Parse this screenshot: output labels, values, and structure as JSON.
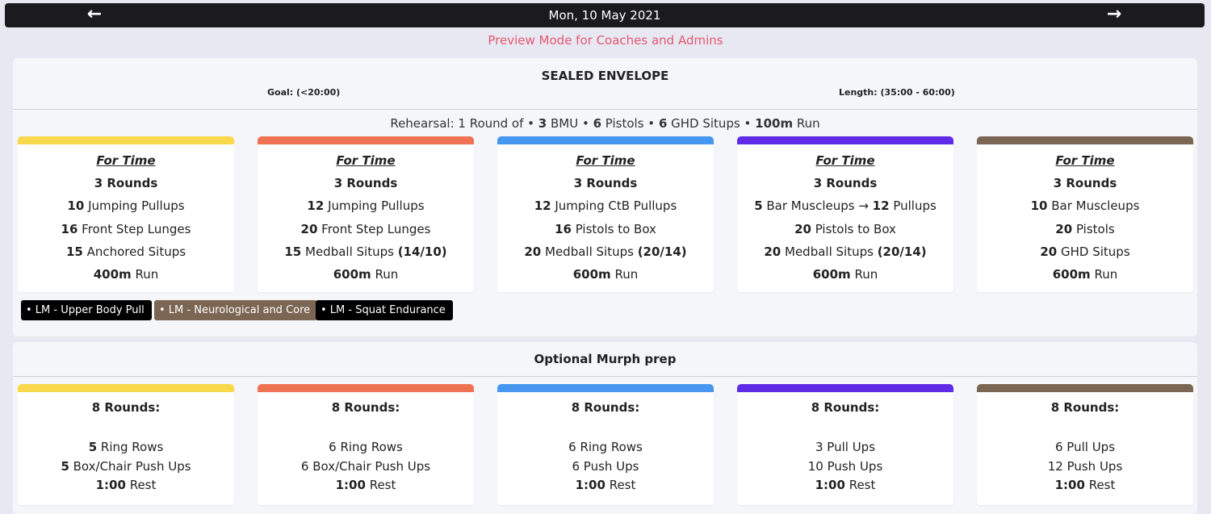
{
  "nav": {
    "prev_icon": "←",
    "next_icon": "→",
    "date": "Mon, 10 May 2021"
  },
  "preview_text": "Preview Mode for Coaches and Admins",
  "colors": {
    "yellow": "#f9d94b",
    "orange": "#ef7352",
    "blue": "#4597f0",
    "purple": "#5f2be6",
    "brown": "#7b6553"
  },
  "workout": {
    "title": "SEALED ENVELOPE",
    "goal": "Goal: (<20:00)",
    "length": "Length: (35:00 - 60:00)",
    "rehearsal": {
      "prefix": "Rehearsal: 1 Round of • ",
      "n1": "3",
      "t1": " BMU • ",
      "n2": "6",
      "t2": " Pistols • ",
      "n3": "6",
      "t3": " GHD Situps • ",
      "n4": "100m",
      "t4": " Run"
    },
    "cards": [
      {
        "color": "#f9d94b",
        "heading": "For Time",
        "rounds": "3 Rounds",
        "l1": {
          "n": "10",
          "t": " Jumping Pullups"
        },
        "l2": {
          "n": "16",
          "t": " Front Step Lunges"
        },
        "l3": {
          "n": "15",
          "t": " Anchored Situps",
          "x": ""
        },
        "l4": {
          "n": "400m",
          "t": " Run"
        }
      },
      {
        "color": "#ef7352",
        "heading": "For Time",
        "rounds": "3 Rounds",
        "l1": {
          "n": "12",
          "t": " Jumping Pullups"
        },
        "l2": {
          "n": "20",
          "t": " Front Step Lunges"
        },
        "l3": {
          "n": "15",
          "t": " Medball Situps ",
          "x": "(14/10)"
        },
        "l4": {
          "n": "600m",
          "t": " Run"
        }
      },
      {
        "color": "#4597f0",
        "heading": "For Time",
        "rounds": "3 Rounds",
        "l1": {
          "n": "12",
          "t": " Jumping CtB Pullups"
        },
        "l2": {
          "n": "16",
          "t": " Pistols to Box"
        },
        "l3": {
          "n": "20",
          "t": " Medball Situps ",
          "x": "(20/14)"
        },
        "l4": {
          "n": "600m",
          "t": " Run"
        }
      },
      {
        "color": "#5f2be6",
        "heading": "For Time",
        "rounds": "3 Rounds",
        "l1": {
          "n": "5",
          "t": " Bar Muscleups → ",
          "n2": "12",
          "t2": " Pullups"
        },
        "l2": {
          "n": "20",
          "t": " Pistols to Box"
        },
        "l3": {
          "n": "20",
          "t": " Medball Situps ",
          "x": "(20/14)"
        },
        "l4": {
          "n": "600m",
          "t": " Run"
        }
      },
      {
        "color": "#7b6553",
        "heading": "For Time",
        "rounds": "3 Rounds",
        "l1": {
          "n": "10",
          "t": " Bar Muscleups"
        },
        "l2": {
          "n": "20",
          "t": " Pistols"
        },
        "l3": {
          "n": "20",
          "t": " GHD Situps",
          "x": ""
        },
        "l4": {
          "n": "600m",
          "t": " Run"
        }
      }
    ],
    "tags": [
      {
        "label": "• LM - Upper Body Pull",
        "color": "#000000"
      },
      {
        "label": "• LM - Neurological and Core",
        "color": "#7b6553"
      },
      {
        "label": "• LM - Squat Endurance",
        "color": "#000000"
      }
    ]
  },
  "optional": {
    "title": "Optional Murph prep",
    "cards": [
      {
        "color": "#f9d94b",
        "rounds": "8 Rounds:",
        "l1": {
          "n": "5",
          "t": " Ring Rows"
        },
        "l2": {
          "n": "5",
          "t": " Box/Chair Push Ups"
        },
        "l3": {
          "n": "1:00",
          "t": " Rest"
        }
      },
      {
        "color": "#ef7352",
        "rounds": "8 Rounds:",
        "l1": {
          "n": "",
          "t": "6 Ring Rows"
        },
        "l2": {
          "n": "",
          "t": "6 Box/Chair Push Ups"
        },
        "l3": {
          "n": "1:00",
          "t": " Rest"
        }
      },
      {
        "color": "#4597f0",
        "rounds": "8 Rounds:",
        "l1": {
          "n": "",
          "t": "6 Ring Rows"
        },
        "l2": {
          "n": "",
          "t": "6 Push Ups"
        },
        "l3": {
          "n": "1:00",
          "t": " Rest"
        }
      },
      {
        "color": "#5f2be6",
        "rounds": "8 Rounds:",
        "l1": {
          "n": "",
          "t": "3 Pull Ups"
        },
        "l2": {
          "n": "",
          "t": "10 Push Ups"
        },
        "l3": {
          "n": "1:00",
          "t": " Rest"
        }
      },
      {
        "color": "#7b6553",
        "rounds": "8 Rounds:",
        "l1": {
          "n": "",
          "t": "6 Pull Ups"
        },
        "l2": {
          "n": "",
          "t": "12 Push Ups"
        },
        "l3": {
          "n": "1:00",
          "t": " Rest"
        }
      }
    ]
  }
}
